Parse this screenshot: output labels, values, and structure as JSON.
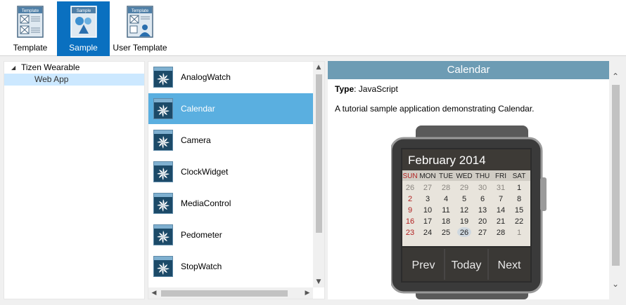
{
  "toolbar": {
    "buttons": [
      {
        "label": "Template",
        "icon_caption": "Template",
        "icon": "template-icon",
        "selected": false
      },
      {
        "label": "Sample",
        "icon_caption": "Sample",
        "icon": "sample-icon",
        "selected": true
      },
      {
        "label": "User Template",
        "icon_caption": "Template",
        "icon": "user-template-icon",
        "selected": false
      }
    ]
  },
  "tree": {
    "items": [
      {
        "label": "Tizen Wearable",
        "expanded": true
      },
      {
        "label": "Web App",
        "selected": true
      }
    ]
  },
  "samples": {
    "items": [
      {
        "label": "AnalogWatch"
      },
      {
        "label": "Calendar"
      },
      {
        "label": "Camera"
      },
      {
        "label": "ClockWidget"
      },
      {
        "label": "MediaControl"
      },
      {
        "label": "Pedometer"
      },
      {
        "label": "StopWatch"
      }
    ],
    "selected_index": 1
  },
  "detail": {
    "title": "Calendar",
    "type_label": "Type",
    "type_value": ": JavaScript",
    "description": "A tutorial sample application demonstrating Calendar.",
    "preview": {
      "month_title": "February 2014",
      "weekdays": [
        "SUN",
        "MON",
        "TUE",
        "WED",
        "THU",
        "FRI",
        "SAT"
      ],
      "weeks": [
        [
          "26",
          "27",
          "28",
          "29",
          "30",
          "31",
          "1"
        ],
        [
          "2",
          "3",
          "4",
          "5",
          "6",
          "7",
          "8"
        ],
        [
          "9",
          "10",
          "11",
          "12",
          "13",
          "14",
          "15"
        ],
        [
          "16",
          "17",
          "18",
          "19",
          "20",
          "21",
          "22"
        ],
        [
          "23",
          "24",
          "25",
          "26",
          "27",
          "28",
          "1"
        ]
      ],
      "today": "26",
      "buttons": [
        "Prev",
        "Today",
        "Next"
      ]
    }
  },
  "colors": {
    "toolbar_selected": "#0a70c0",
    "list_selected": "#5aafe0",
    "tree_selected": "#cce8ff",
    "detail_header": "#6d9cb4",
    "sunday_red": "#b22222"
  }
}
